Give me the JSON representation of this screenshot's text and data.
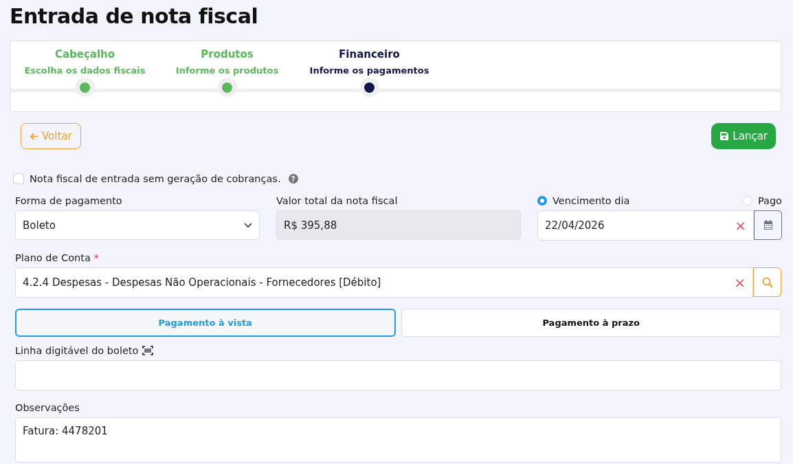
{
  "title": "Entrada de nota fiscal",
  "steps": [
    {
      "title": "Cabeçalho",
      "subtitle": "Escolha os dados fiscais",
      "completed": true
    },
    {
      "title": "Produtos",
      "subtitle": "Informe os produtos",
      "completed": true
    },
    {
      "title": "Financeiro",
      "subtitle": "Informe os pagamentos",
      "completed": false
    }
  ],
  "back_button": "Voltar",
  "submit_button": "Lançar",
  "no_charges": {
    "label": "Nota fiscal de entrada sem geração de cobranças.",
    "checked": false,
    "help": "?"
  },
  "payment_method": {
    "label": "Forma de pagamento",
    "value": "Boleto"
  },
  "total": {
    "label": "Valor total da nota fiscal",
    "value": "R$ 395,88"
  },
  "due_options": [
    {
      "label": "Vencimento dia",
      "selected": true
    },
    {
      "label": "Pago",
      "selected": false
    }
  ],
  "due_date": {
    "value": "22/04/2026",
    "clear": "×"
  },
  "account_plan": {
    "label": "Plano de Conta",
    "required": "*",
    "value": "4.2.4  Despesas - Despesas Não Operacionais - Fornecedores [Débito]",
    "clear": "×"
  },
  "payment_tabs": [
    {
      "label": "Pagamento à vista",
      "selected": true
    },
    {
      "label": "Pagamento à prazo",
      "selected": false
    }
  ],
  "barcode_line": {
    "label": "Linha digitável do boleto"
  },
  "notes": {
    "label": "Observações",
    "value": "Fatura: 4478201"
  }
}
